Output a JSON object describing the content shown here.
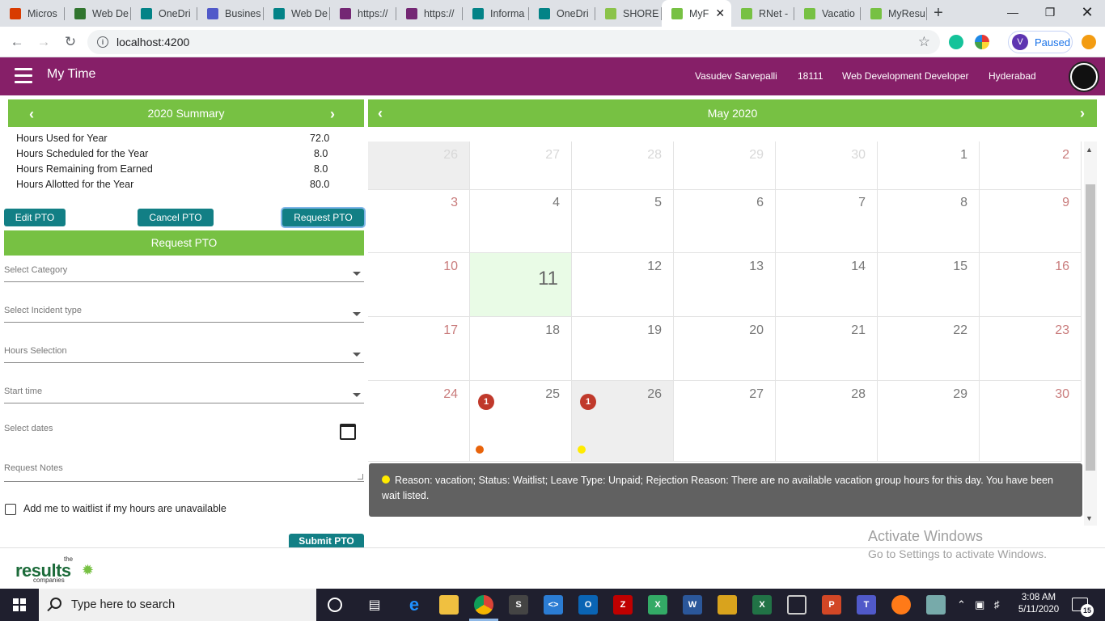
{
  "browser": {
    "tabs": [
      {
        "label": "Micros",
        "icon": "office-icon",
        "color": "#d83b01"
      },
      {
        "label": "Web De",
        "icon": "planner-icon",
        "color": "#31752f"
      },
      {
        "label": "OneDri",
        "icon": "sharepoint-icon",
        "color": "#038387"
      },
      {
        "label": "Busines",
        "icon": "teams-icon",
        "color": "#5059c9"
      },
      {
        "label": "Web De",
        "icon": "sharepoint-icon",
        "color": "#038387"
      },
      {
        "label": "https://",
        "icon": "powerapps-icon",
        "color": "#742774"
      },
      {
        "label": "https://",
        "icon": "powerapps-icon",
        "color": "#742774"
      },
      {
        "label": "Informa",
        "icon": "sharepoint-icon",
        "color": "#038387"
      },
      {
        "label": "OneDri",
        "icon": "sharepoint-icon",
        "color": "#038387"
      },
      {
        "label": "SHORE",
        "icon": "shore-icon",
        "color": "#8bc34a"
      },
      {
        "label": "MyF",
        "icon": "results-icon",
        "color": "#77c143",
        "active": true
      },
      {
        "label": "RNet - ",
        "icon": "results-icon",
        "color": "#77c143"
      },
      {
        "label": "Vacatio",
        "icon": "results-icon",
        "color": "#77c143"
      },
      {
        "label": "MyResu",
        "icon": "results-icon",
        "color": "#77c143"
      }
    ],
    "url": "localhost:4200",
    "profile_initial": "V",
    "profile_status": "Paused"
  },
  "header": {
    "title": "My Time",
    "user_name": "Vasudev Sarvepalli",
    "employee_id": "18111",
    "role": "Web Development Developer",
    "location": "Hyderabad"
  },
  "summary": {
    "title": "2020 Summary",
    "rows": [
      {
        "label": "Hours Used for Year",
        "value": "72.0"
      },
      {
        "label": "Hours Scheduled for the Year",
        "value": "8.0"
      },
      {
        "label": "Hours Remaining from Earned",
        "value": "8.0"
      },
      {
        "label": "Hours Allotted for the Year",
        "value": "80.0"
      }
    ]
  },
  "actions": {
    "edit": "Edit PTO",
    "cancel": "Cancel PTO",
    "request": "Request PTO"
  },
  "form": {
    "title": "Request PTO",
    "category_placeholder": "Select Category",
    "incident_placeholder": "Select Incident type",
    "hours_placeholder": "Hours Selection",
    "start_placeholder": "Start time",
    "dates_placeholder": "Select dates",
    "notes_placeholder": "Request Notes",
    "waitlist_label": "Add me to waitlist if my hours are unavailable",
    "submit": "Submit PTO"
  },
  "calendar": {
    "title": "May 2020",
    "weeks": [
      [
        "26",
        "27",
        "28",
        "29",
        "30",
        "1",
        "2"
      ],
      [
        "3",
        "4",
        "5",
        "6",
        "7",
        "8",
        "9"
      ],
      [
        "10",
        "11",
        "12",
        "13",
        "14",
        "15",
        "16"
      ],
      [
        "17",
        "18",
        "19",
        "20",
        "21",
        "22",
        "23"
      ],
      [
        "24",
        "25",
        "26",
        "27",
        "28",
        "29",
        "30"
      ]
    ],
    "badges": {
      "25": "1",
      "26": "1"
    },
    "tooltip": "Reason: vacation; Status: Waitlist; Leave Type: Unpaid; Rejection Reason: There are no available vacation group hours for this day. You have been wait listed.",
    "colors": {
      "orange_dot": "#e8630a",
      "yellow_dot": "#ffeb00",
      "badge": "#c0392b"
    }
  },
  "footer": {
    "logo_the": "the",
    "logo_results": "results",
    "logo_companies": "companies"
  },
  "watermark": {
    "line1": "Activate Windows",
    "line2": "Go to Settings to activate Windows."
  },
  "taskbar": {
    "search_placeholder": "Type here to search",
    "time": "3:08 AM",
    "date": "5/11/2020",
    "notification_count": "15"
  }
}
